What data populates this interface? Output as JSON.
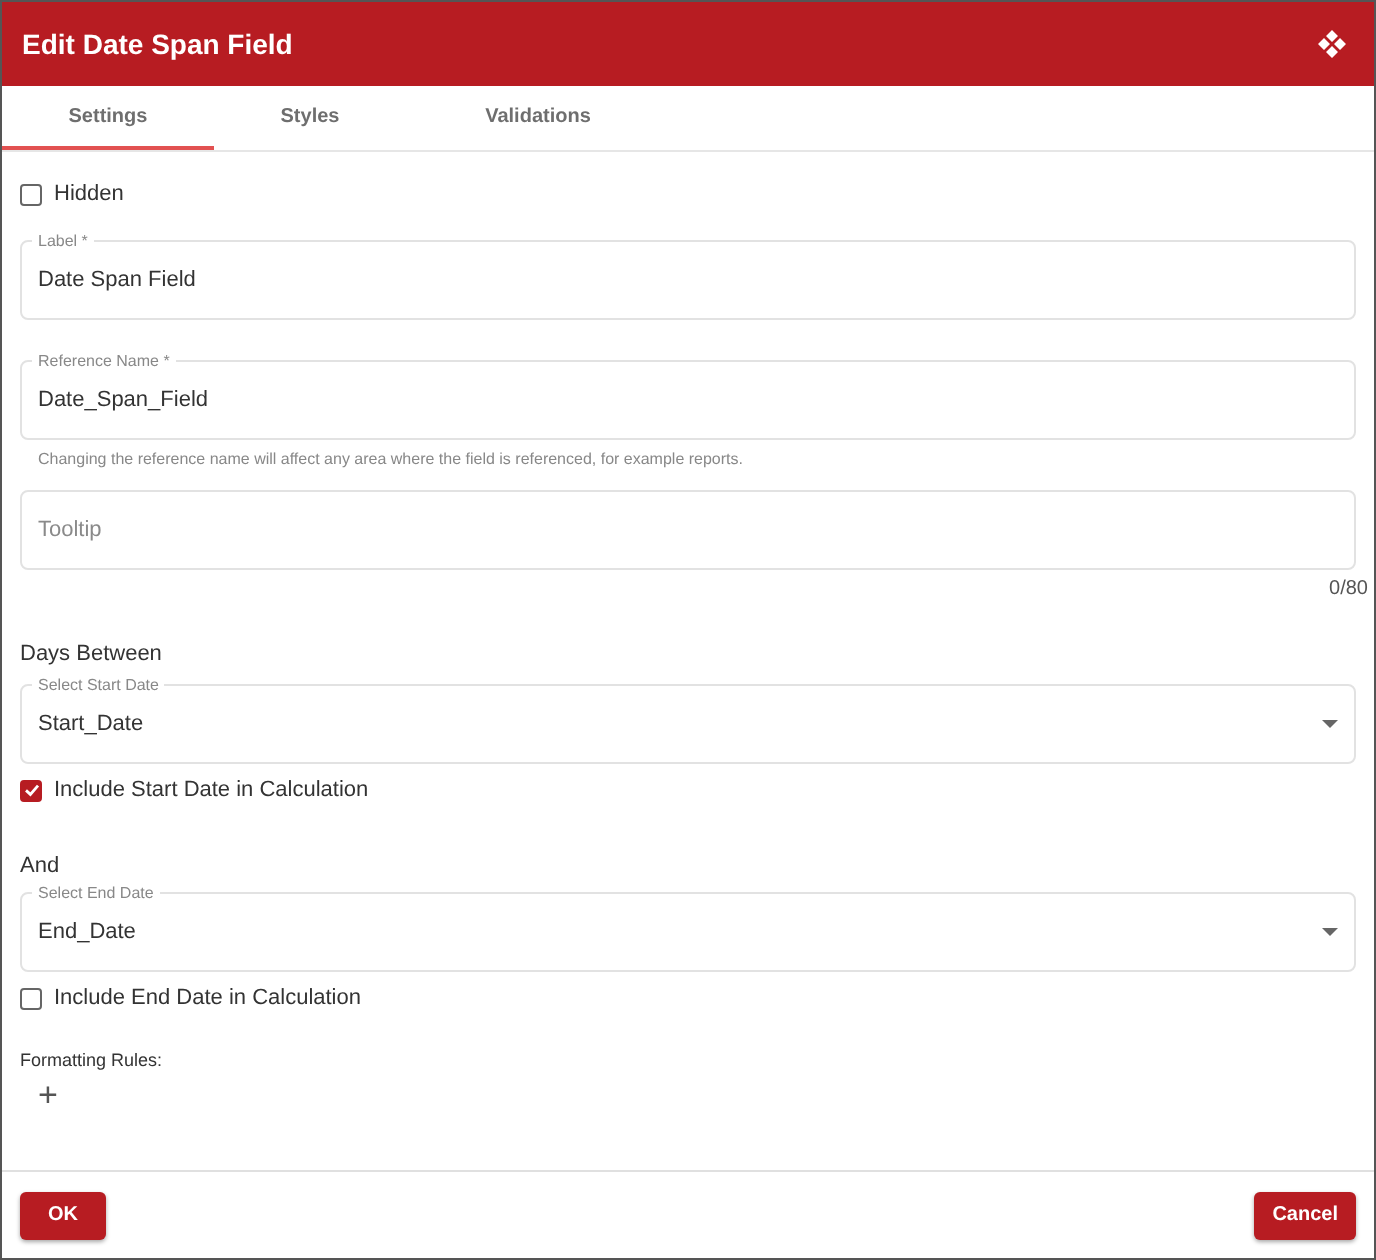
{
  "dialog": {
    "title": "Edit Date Span Field"
  },
  "tabs": [
    {
      "label": "Settings",
      "selected": true
    },
    {
      "label": "Styles",
      "selected": false
    },
    {
      "label": "Validations",
      "selected": false
    }
  ],
  "settings": [
    {
      "kind": "checkbox",
      "label": "Hidden",
      "checked": false
    },
    {
      "kind": "field",
      "label": "Label *",
      "value": "Date Span Field"
    },
    {
      "kind": "field",
      "label": "Reference Name *",
      "value": "Date_Span_Field",
      "hint": "Changing the reference name will affect any area where the field is referenced, for example reports."
    },
    {
      "kind": "field",
      "placeholder": "Tooltip",
      "counter": "0/80"
    },
    {
      "kind": "heading",
      "text": "Days Between"
    },
    {
      "kind": "select",
      "label": "Select Start Date",
      "value": "Start_Date"
    },
    {
      "kind": "checkbox",
      "label": "Include Start Date in Calculation",
      "checked": true
    },
    {
      "kind": "heading",
      "text": "And"
    },
    {
      "kind": "select",
      "label": "Select End Date",
      "value": "End_Date"
    },
    {
      "kind": "checkbox",
      "label": "Include End Date in Calculation",
      "checked": false
    },
    {
      "kind": "subheading",
      "text": "Formatting Rules:"
    },
    {
      "kind": "add",
      "symbol": "+"
    }
  ],
  "buttons": [
    {
      "label": "OK"
    },
    {
      "label": "Cancel"
    }
  ]
}
